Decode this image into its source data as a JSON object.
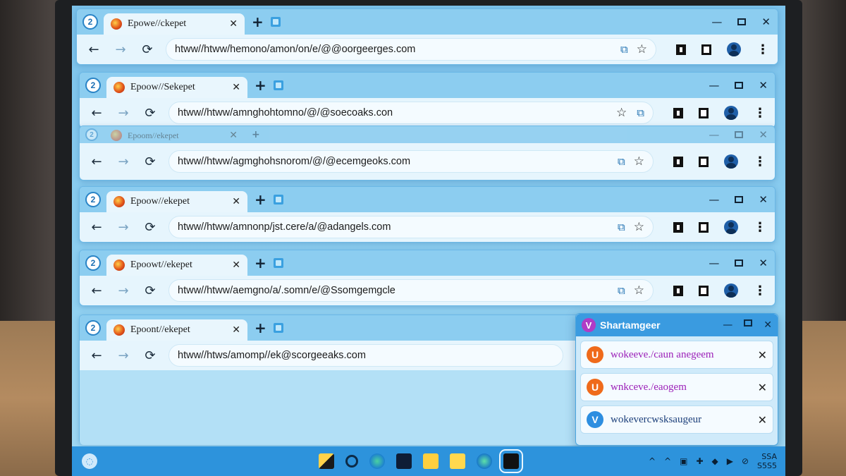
{
  "windows": [
    {
      "tab_title": "Epowe//ckepet",
      "url": "htww//htww/hemono/amon/on/e/@@oorgeerges.com",
      "app_logo": "2"
    },
    {
      "tab_title": "Epoow//Sekepet",
      "url": "htww//htww/amnghohtomno/@/@soecoaks.con",
      "app_logo": "2"
    },
    {
      "tab_title": "Epoom//ekepet",
      "url": "htww//htww/agmghohsnorom/@/@ecemgeoks.com",
      "app_logo": "2"
    },
    {
      "tab_title": "Epoow//ekepet",
      "url": "htww//htww/amnonp/jst.cere/a/@adangels.com",
      "app_logo": "2"
    },
    {
      "tab_title": "Epoowt//ekepet",
      "url": "htww//htww/aemgno/a/.somn/e/@Ssomgemgcle",
      "app_logo": "2"
    },
    {
      "tab_title": "Epoont//ekepet",
      "url": "htww//htws/amomp//ek@scorgeeaks.com",
      "app_logo": "2"
    }
  ],
  "nav": {
    "back": "←",
    "forward": "→",
    "reload": "⟳"
  },
  "tab_controls": {
    "close": "✕",
    "new_tab": "+"
  },
  "window_controls": {
    "minimize": "—",
    "close": "✕"
  },
  "toolbar_icons": {
    "star": "☆",
    "extension": "⧉",
    "menu": "⋮"
  },
  "popup": {
    "logo": "V",
    "title": "Shartamgeer",
    "items": [
      {
        "icon": "U",
        "icon_color": "#ef6a1b",
        "text": "wokeeve./caun anegeem",
        "text_color": "#9b1fb8"
      },
      {
        "icon": "U",
        "icon_color": "#ef6a1b",
        "text": "wnkceve./eaogem",
        "text_color": "#9b1fb8"
      },
      {
        "icon": "V",
        "icon_color": "#2d8ee0",
        "text": "wokevercwsksaugeur",
        "text_color": "#1c3f7a"
      }
    ],
    "close": "✕"
  },
  "taskbar": {
    "start_icon": "◌",
    "tray_icons": [
      "^",
      "^",
      "▣",
      "✚",
      "◆",
      "▶",
      "⊘"
    ],
    "clock_line1": "SSA",
    "clock_line2": "S5S5"
  },
  "colors": {
    "screen_bg": "#8fd0f1",
    "taskbar": "#2d93dc",
    "accent": "#1d6fb0"
  }
}
